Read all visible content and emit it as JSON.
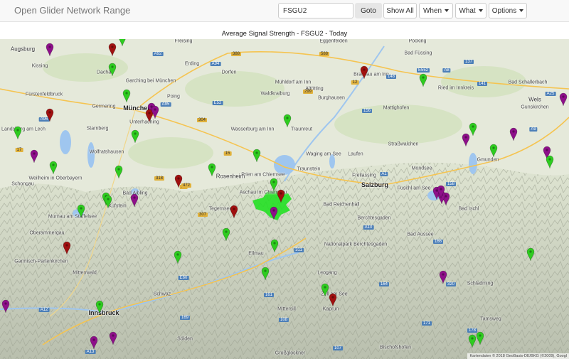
{
  "navbar": {
    "brand": "Open Glider Network Range",
    "search_value": "FSGU2",
    "goto_label": "Goto",
    "show_all_label": "Show All",
    "when_label": "When",
    "what_label": "What",
    "options_label": "Options"
  },
  "map": {
    "title": "Average Signal Strength - FSGU2 - Today",
    "attribution": "Kartendaten © 2018 GeoBasis-DE/BKG (©2009), Googl",
    "colors": {
      "marker_green": "#2ecc1f",
      "marker_red": "#a01010",
      "marker_purple": "#8e0f8a",
      "coverage": "#19e01a",
      "lake": "#9fc6ef"
    },
    "places": [
      {
        "name": "Augsburg",
        "cls": "med"
      },
      {
        "name": "Freising",
        "cls": ""
      },
      {
        "name": "Eggenfelden",
        "cls": ""
      },
      {
        "name": "Pocking",
        "cls": ""
      },
      {
        "name": "Dachau",
        "cls": ""
      },
      {
        "name": "Erding",
        "cls": ""
      },
      {
        "name": "Bad Füssing",
        "cls": ""
      },
      {
        "name": "Garching bei München",
        "cls": ""
      },
      {
        "name": "Dorfen",
        "cls": ""
      },
      {
        "name": "Mühldorf am Inn",
        "cls": ""
      },
      {
        "name": "Braunau am Inn",
        "cls": ""
      },
      {
        "name": "Kissing",
        "cls": ""
      },
      {
        "name": "Fürstenfeldbruck",
        "cls": ""
      },
      {
        "name": "Poing",
        "cls": ""
      },
      {
        "name": "Waldkraiburg",
        "cls": ""
      },
      {
        "name": "Altötting",
        "cls": ""
      },
      {
        "name": "Burghausen",
        "cls": ""
      },
      {
        "name": "Ried im Innkreis",
        "cls": ""
      },
      {
        "name": "Bad Schallerbach",
        "cls": ""
      },
      {
        "name": "Germering",
        "cls": ""
      },
      {
        "name": "München",
        "cls": "big"
      },
      {
        "name": "Unterhaching",
        "cls": ""
      },
      {
        "name": "Wels",
        "cls": "med"
      },
      {
        "name": "Gunskirchen",
        "cls": ""
      },
      {
        "name": "Mattighofen",
        "cls": ""
      },
      {
        "name": "Landsberg am Lech",
        "cls": ""
      },
      {
        "name": "Starnberg",
        "cls": ""
      },
      {
        "name": "Wasserburg am Inn",
        "cls": ""
      },
      {
        "name": "Traunreut",
        "cls": ""
      },
      {
        "name": "Waging am See",
        "cls": ""
      },
      {
        "name": "Straßwalchen",
        "cls": ""
      },
      {
        "name": "Wolfratshausen",
        "cls": ""
      },
      {
        "name": "Laufen",
        "cls": ""
      },
      {
        "name": "Gmunden",
        "cls": ""
      },
      {
        "name": "Schongau",
        "cls": ""
      },
      {
        "name": "Weilheim in Oberbayern",
        "cls": ""
      },
      {
        "name": "Rosenheim",
        "cls": "med"
      },
      {
        "name": "Prien am Chiemsee",
        "cls": ""
      },
      {
        "name": "Traunstein",
        "cls": ""
      },
      {
        "name": "Freilassing",
        "cls": ""
      },
      {
        "name": "Mondsee",
        "cls": ""
      },
      {
        "name": "Salzburg",
        "cls": "big"
      },
      {
        "name": "Fuschl am See",
        "cls": ""
      },
      {
        "name": "Bad Aibling",
        "cls": ""
      },
      {
        "name": "Aschau im Chiemgau",
        "cls": ""
      },
      {
        "name": "Tegernsee",
        "cls": ""
      },
      {
        "name": "Bad Reichenhall",
        "cls": ""
      },
      {
        "name": "Bad Ischl",
        "cls": ""
      },
      {
        "name": "Murnau am Staffelsee",
        "cls": ""
      },
      {
        "name": "Berchtesgaden",
        "cls": ""
      },
      {
        "name": "Oberammergau",
        "cls": ""
      },
      {
        "name": "Bad Aussee",
        "cls": ""
      },
      {
        "name": "Garmisch-Partenkirchen",
        "cls": ""
      },
      {
        "name": "Ellmau",
        "cls": ""
      },
      {
        "name": "Nationalpark Berchtesgaden",
        "cls": ""
      },
      {
        "name": "Mittenwald",
        "cls": ""
      },
      {
        "name": "Leogang",
        "cls": ""
      },
      {
        "name": "Schladming",
        "cls": ""
      },
      {
        "name": "Innsbruck",
        "cls": "big"
      },
      {
        "name": "Zell am See",
        "cls": ""
      },
      {
        "name": "Kaprun",
        "cls": ""
      },
      {
        "name": "Mittersill",
        "cls": ""
      },
      {
        "name": "Großglockner",
        "cls": ""
      },
      {
        "name": "Bischofshofen",
        "cls": ""
      },
      {
        "name": "Tamsweg",
        "cls": ""
      },
      {
        "name": "Schwaz",
        "cls": ""
      },
      {
        "name": "Kufstein",
        "cls": ""
      },
      {
        "name": "Sölden",
        "cls": ""
      }
    ],
    "routes": [
      {
        "label": "A8",
        "type": "b"
      },
      {
        "label": "A9",
        "type": "b"
      },
      {
        "label": "A92",
        "type": "b"
      },
      {
        "label": "A94",
        "type": "b"
      },
      {
        "label": "A95",
        "type": "b"
      },
      {
        "label": "A96",
        "type": "b"
      },
      {
        "label": "A1",
        "type": "b"
      },
      {
        "label": "A10",
        "type": "b"
      },
      {
        "label": "A12",
        "type": "b"
      },
      {
        "label": "A13",
        "type": "b"
      },
      {
        "label": "A25",
        "type": "b"
      },
      {
        "label": "E60",
        "type": "b"
      },
      {
        "label": "E52",
        "type": "b"
      },
      {
        "label": "E552",
        "type": "b"
      },
      {
        "label": "17",
        "type": "y"
      },
      {
        "label": "12",
        "type": "y"
      },
      {
        "label": "15",
        "type": "y"
      },
      {
        "label": "20",
        "type": "y"
      },
      {
        "label": "299",
        "type": "y"
      },
      {
        "label": "304",
        "type": "y"
      },
      {
        "label": "318",
        "type": "y"
      },
      {
        "label": "472",
        "type": "y"
      },
      {
        "label": "307",
        "type": "y"
      },
      {
        "label": "388",
        "type": "y"
      },
      {
        "label": "588",
        "type": "y"
      },
      {
        "label": "148",
        "type": "b"
      },
      {
        "label": "156",
        "type": "b"
      },
      {
        "label": "141",
        "type": "b"
      },
      {
        "label": "137",
        "type": "b"
      },
      {
        "label": "158",
        "type": "b"
      },
      {
        "label": "166",
        "type": "b"
      },
      {
        "label": "161",
        "type": "b"
      },
      {
        "label": "171",
        "type": "b"
      },
      {
        "label": "169",
        "type": "b"
      },
      {
        "label": "320",
        "type": "b"
      },
      {
        "label": "311",
        "type": "b"
      },
      {
        "label": "178",
        "type": "b"
      },
      {
        "label": "108",
        "type": "b"
      },
      {
        "label": "107",
        "type": "b"
      },
      {
        "label": "164",
        "type": "b"
      }
    ],
    "markers": [
      {
        "name": "station-marker",
        "color": "purple"
      },
      {
        "name": "station-marker",
        "color": "red"
      },
      {
        "name": "station-marker",
        "color": "green"
      },
      {
        "name": "station-marker",
        "color": "green"
      },
      {
        "name": "station-marker",
        "color": "green"
      },
      {
        "name": "station-marker",
        "color": "purple"
      },
      {
        "name": "station-marker",
        "color": "red"
      },
      {
        "name": "station-marker",
        "color": "purple"
      },
      {
        "name": "station-marker",
        "color": "green"
      },
      {
        "name": "station-marker",
        "color": "red"
      },
      {
        "name": "station-marker",
        "color": "red"
      },
      {
        "name": "station-marker",
        "color": "green"
      },
      {
        "name": "station-marker",
        "color": "green"
      },
      {
        "name": "station-marker",
        "color": "green"
      },
      {
        "name": "station-marker",
        "color": "purple"
      },
      {
        "name": "station-marker",
        "color": "green"
      },
      {
        "name": "station-marker",
        "color": "purple"
      },
      {
        "name": "station-marker",
        "color": "purple"
      },
      {
        "name": "station-marker",
        "color": "green"
      },
      {
        "name": "station-marker",
        "color": "green"
      },
      {
        "name": "station-marker",
        "color": "purple"
      },
      {
        "name": "station-marker",
        "color": "green"
      },
      {
        "name": "station-marker",
        "color": "green"
      },
      {
        "name": "station-marker",
        "color": "red"
      },
      {
        "name": "station-marker",
        "color": "green"
      },
      {
        "name": "station-marker",
        "color": "red"
      },
      {
        "name": "station-marker",
        "color": "green"
      },
      {
        "name": "station-marker",
        "color": "green"
      },
      {
        "name": "station-marker",
        "color": "purple"
      },
      {
        "name": "station-marker",
        "color": "purple"
      },
      {
        "name": "station-marker",
        "color": "purple"
      },
      {
        "name": "station-marker",
        "color": "green"
      },
      {
        "name": "station-marker",
        "color": "green"
      },
      {
        "name": "station-marker",
        "color": "red"
      },
      {
        "name": "station-marker",
        "color": "purple"
      },
      {
        "name": "station-marker",
        "color": "green"
      },
      {
        "name": "station-marker",
        "color": "red"
      },
      {
        "name": "station-marker",
        "color": "green"
      },
      {
        "name": "station-marker",
        "color": "purple"
      },
      {
        "name": "station-marker",
        "color": "green"
      },
      {
        "name": "station-marker",
        "color": "green"
      },
      {
        "name": "station-marker",
        "color": "red"
      },
      {
        "name": "station-marker",
        "color": "purple"
      },
      {
        "name": "station-marker",
        "color": "purple"
      },
      {
        "name": "station-marker",
        "color": "green"
      },
      {
        "name": "station-marker",
        "color": "purple"
      },
      {
        "name": "station-marker",
        "color": "green"
      },
      {
        "name": "station-marker",
        "color": "green"
      },
      {
        "name": "station-marker",
        "color": "purple"
      },
      {
        "name": "station-marker",
        "color": "purple"
      },
      {
        "name": "station-marker",
        "color": "green"
      },
      {
        "name": "station-marker",
        "color": "green"
      },
      {
        "name": "station-marker",
        "color": "purple"
      },
      {
        "name": "station-marker",
        "color": "green"
      }
    ]
  }
}
